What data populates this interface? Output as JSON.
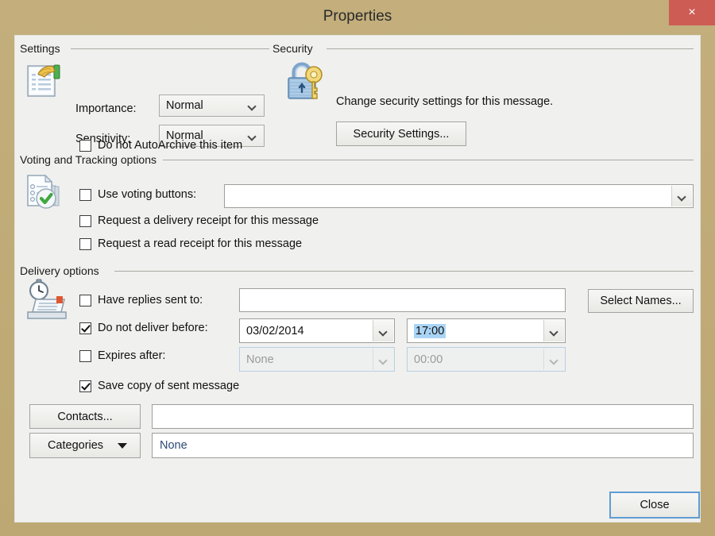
{
  "window": {
    "title": "Properties",
    "close_label": "×",
    "frame_color": "#c0ab78",
    "close_color": "#cd5c55",
    "client_bg": "#f0f0ee"
  },
  "settings": {
    "group_label": "Settings",
    "icon": "document-hand-icon",
    "importance_label": "Importance:",
    "importance_value": "Normal",
    "sensitivity_label": "Sensitivity:",
    "sensitivity_value": "Normal",
    "autoarchive_label": "Do not AutoArchive this item",
    "autoarchive_checked": false
  },
  "security": {
    "group_label": "Security",
    "icon": "lock-key-icon",
    "description": "Change security settings for this message.",
    "settings_button": "Security Settings..."
  },
  "voting": {
    "group_label": "Voting and Tracking options",
    "icon": "checklist-check-icon",
    "use_voting_label": "Use voting buttons:",
    "use_voting_checked": false,
    "voting_value": "",
    "delivery_receipt_label": "Request a delivery receipt for this message",
    "delivery_receipt_checked": false,
    "read_receipt_label": "Request a read receipt for this message",
    "read_receipt_checked": false
  },
  "delivery": {
    "group_label": "Delivery options",
    "icon": "clock-envelope-icon",
    "have_replies_label": "Have replies sent to:",
    "have_replies_checked": false,
    "have_replies_value": "",
    "select_names_button": "Select Names...",
    "not_before_label": "Do not deliver before:",
    "not_before_checked": true,
    "not_before_date": "03/02/2014",
    "not_before_time": "17:00",
    "expires_label": "Expires after:",
    "expires_checked": false,
    "expires_date": "None",
    "expires_time": "00:00",
    "save_copy_label": "Save copy of sent message",
    "save_copy_checked": true,
    "contacts_button": "Contacts...",
    "contacts_value": "",
    "categories_button": "Categories",
    "categories_value": "None"
  },
  "footer": {
    "close_button": "Close"
  }
}
